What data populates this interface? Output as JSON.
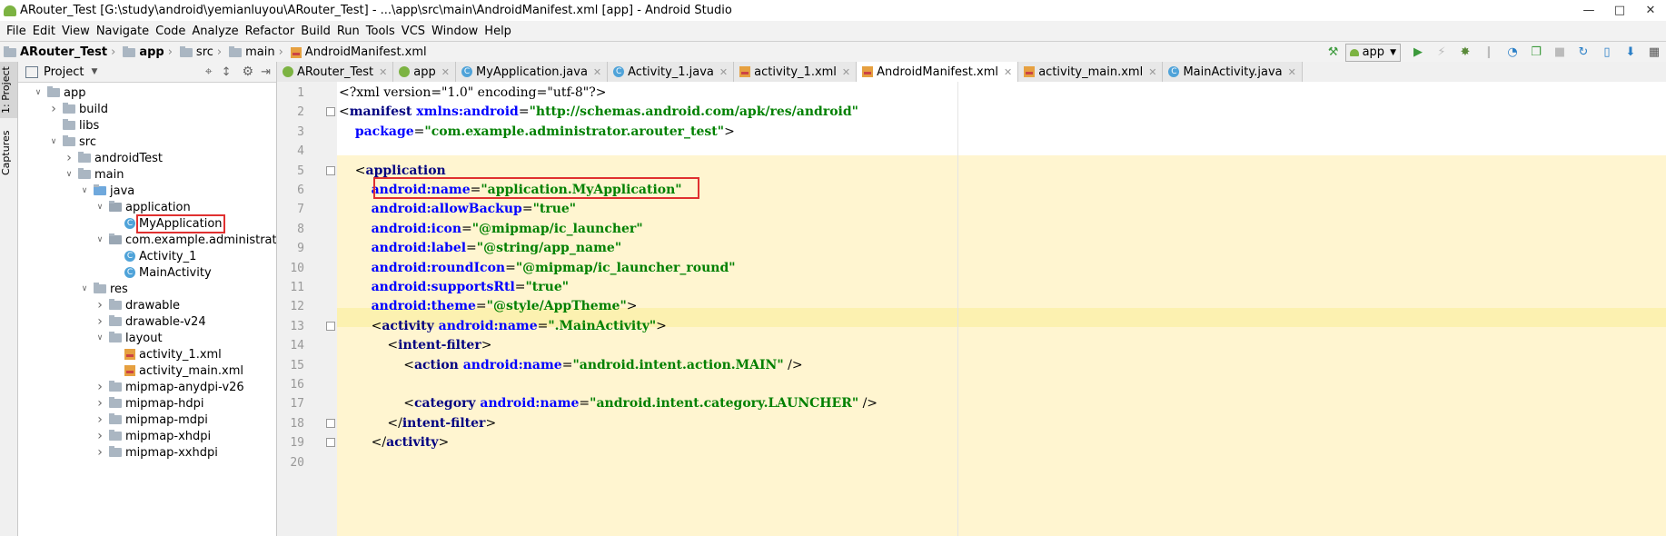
{
  "window": {
    "title": "ARouter_Test [G:\\study\\android\\yemianluyou\\ARouter_Test] - ...\\app\\src\\main\\AndroidManifest.xml [app] - Android Studio"
  },
  "menu": [
    "File",
    "Edit",
    "View",
    "Navigate",
    "Code",
    "Analyze",
    "Refactor",
    "Build",
    "Run",
    "Tools",
    "VCS",
    "Window",
    "Help"
  ],
  "breadcrumb": [
    "ARouter_Test",
    "app",
    "src",
    "main",
    "AndroidManifest.xml"
  ],
  "toolbar": {
    "run_config": "app"
  },
  "toolstrip": {
    "project_tab": "1: Project",
    "captures_tab": "Captures"
  },
  "project_panel": {
    "title": "Project"
  },
  "tree": [
    {
      "label": "app",
      "depth": 0,
      "open": true,
      "type": "folder"
    },
    {
      "label": "build",
      "depth": 1,
      "open": false,
      "type": "folder"
    },
    {
      "label": "libs",
      "depth": 1,
      "open": null,
      "type": "folder"
    },
    {
      "label": "src",
      "depth": 1,
      "open": true,
      "type": "folder"
    },
    {
      "label": "androidTest",
      "depth": 2,
      "open": false,
      "type": "folder"
    },
    {
      "label": "main",
      "depth": 2,
      "open": true,
      "type": "folder"
    },
    {
      "label": "java",
      "depth": 3,
      "open": true,
      "type": "folder"
    },
    {
      "label": "application",
      "depth": 4,
      "open": true,
      "type": "package"
    },
    {
      "label": "MyApplication",
      "depth": 5,
      "open": null,
      "type": "class",
      "highlight": true
    },
    {
      "label": "com.example.administrator.arouter_test",
      "depth": 4,
      "open": true,
      "type": "package"
    },
    {
      "label": "Activity_1",
      "depth": 5,
      "open": null,
      "type": "class"
    },
    {
      "label": "MainActivity",
      "depth": 5,
      "open": null,
      "type": "class"
    },
    {
      "label": "res",
      "depth": 3,
      "open": true,
      "type": "folder"
    },
    {
      "label": "drawable",
      "depth": 4,
      "open": false,
      "type": "folder"
    },
    {
      "label": "drawable-v24",
      "depth": 4,
      "open": false,
      "type": "folder"
    },
    {
      "label": "layout",
      "depth": 4,
      "open": true,
      "type": "folder"
    },
    {
      "label": "activity_1.xml",
      "depth": 5,
      "open": null,
      "type": "xml"
    },
    {
      "label": "activity_main.xml",
      "depth": 5,
      "open": null,
      "type": "xml"
    },
    {
      "label": "mipmap-anydpi-v26",
      "depth": 4,
      "open": false,
      "type": "folder"
    },
    {
      "label": "mipmap-hdpi",
      "depth": 4,
      "open": false,
      "type": "folder"
    },
    {
      "label": "mipmap-mdpi",
      "depth": 4,
      "open": false,
      "type": "folder"
    },
    {
      "label": "mipmap-xhdpi",
      "depth": 4,
      "open": false,
      "type": "folder"
    },
    {
      "label": "mipmap-xxhdpi",
      "depth": 4,
      "open": false,
      "type": "folder"
    }
  ],
  "tabs": [
    {
      "label": "ARouter_Test",
      "active": false
    },
    {
      "label": "app",
      "active": false
    },
    {
      "label": "MyApplication.java",
      "active": false
    },
    {
      "label": "Activity_1.java",
      "active": false
    },
    {
      "label": "activity_1.xml",
      "active": false
    },
    {
      "label": "AndroidManifest.xml",
      "active": true
    },
    {
      "label": "activity_main.xml",
      "active": false
    },
    {
      "label": "MainActivity.java",
      "active": false
    }
  ],
  "code": [
    {
      "n": "1",
      "parts": [
        [
          "pl",
          "<?xml version=\"1.0\" encoding=\"utf-8\"?>"
        ]
      ]
    },
    {
      "n": "2",
      "parts": [
        [
          "pl",
          "<"
        ],
        [
          "tg",
          "manifest "
        ],
        [
          "at",
          "xmlns:android"
        ],
        [
          "pl",
          "="
        ],
        [
          "vl",
          "\"http://schemas.android.com/apk/res/android\""
        ]
      ]
    },
    {
      "n": "3",
      "parts": [
        [
          "pl",
          "    "
        ],
        [
          "at",
          "package"
        ],
        [
          "pl",
          "="
        ],
        [
          "vl",
          "\"com.example.administrator.arouter_test\""
        ],
        [
          "pl",
          ">"
        ]
      ]
    },
    {
      "n": "4",
      "parts": []
    },
    {
      "n": "5",
      "parts": [
        [
          "pl",
          "    <"
        ],
        [
          "tg",
          "application"
        ]
      ]
    },
    {
      "n": "6",
      "parts": [
        [
          "pl",
          "        "
        ],
        [
          "at",
          "android:name"
        ],
        [
          "pl",
          "="
        ],
        [
          "vl",
          "\"application.MyApplication\""
        ]
      ]
    },
    {
      "n": "7",
      "parts": [
        [
          "pl",
          "        "
        ],
        [
          "at",
          "android:allowBackup"
        ],
        [
          "pl",
          "="
        ],
        [
          "vl",
          "\"true\""
        ]
      ]
    },
    {
      "n": "8",
      "parts": [
        [
          "pl",
          "        "
        ],
        [
          "at",
          "android:icon"
        ],
        [
          "pl",
          "="
        ],
        [
          "vl",
          "\"@mipmap/ic_launcher\""
        ]
      ]
    },
    {
      "n": "9",
      "parts": [
        [
          "pl",
          "        "
        ],
        [
          "at",
          "android:label"
        ],
        [
          "pl",
          "="
        ],
        [
          "vl",
          "\"@string/app_name\""
        ]
      ]
    },
    {
      "n": "10",
      "parts": [
        [
          "pl",
          "        "
        ],
        [
          "at",
          "android:roundIcon"
        ],
        [
          "pl",
          "="
        ],
        [
          "vl",
          "\"@mipmap/ic_launcher_round\""
        ]
      ]
    },
    {
      "n": "11",
      "parts": [
        [
          "pl",
          "        "
        ],
        [
          "at",
          "android:supportsRtl"
        ],
        [
          "pl",
          "="
        ],
        [
          "vl",
          "\"true\""
        ]
      ]
    },
    {
      "n": "12",
      "parts": [
        [
          "pl",
          "        "
        ],
        [
          "at",
          "android:theme"
        ],
        [
          "pl",
          "="
        ],
        [
          "vl",
          "\"@style/AppTheme\""
        ],
        [
          "pl",
          ">"
        ]
      ]
    },
    {
      "n": "13",
      "parts": [
        [
          "pl",
          "        <"
        ],
        [
          "tg",
          "activity "
        ],
        [
          "at",
          "android:name"
        ],
        [
          "pl",
          "="
        ],
        [
          "vl",
          "\".MainActivity\""
        ],
        [
          "pl",
          ">"
        ]
      ]
    },
    {
      "n": "14",
      "parts": [
        [
          "pl",
          "            <"
        ],
        [
          "tg",
          "intent-filter"
        ],
        [
          "pl",
          ">"
        ]
      ]
    },
    {
      "n": "15",
      "parts": [
        [
          "pl",
          "                <"
        ],
        [
          "tg",
          "action "
        ],
        [
          "at",
          "android:name"
        ],
        [
          "pl",
          "="
        ],
        [
          "vl",
          "\"android.intent.action.MAIN\""
        ],
        [
          "pl",
          " />"
        ]
      ]
    },
    {
      "n": "16",
      "parts": []
    },
    {
      "n": "17",
      "parts": [
        [
          "pl",
          "                <"
        ],
        [
          "tg",
          "category "
        ],
        [
          "at",
          "android:name"
        ],
        [
          "pl",
          "="
        ],
        [
          "vl",
          "\"android.intent.category.LAUNCHER\""
        ],
        [
          "pl",
          " />"
        ]
      ]
    },
    {
      "n": "18",
      "parts": [
        [
          "pl",
          "            </"
        ],
        [
          "tg",
          "intent-filter"
        ],
        [
          "pl",
          ">"
        ]
      ]
    },
    {
      "n": "19",
      "parts": [
        [
          "pl",
          "        </"
        ],
        [
          "tg",
          "activity"
        ],
        [
          "pl",
          ">"
        ]
      ]
    },
    {
      "n": "20",
      "parts": []
    }
  ]
}
